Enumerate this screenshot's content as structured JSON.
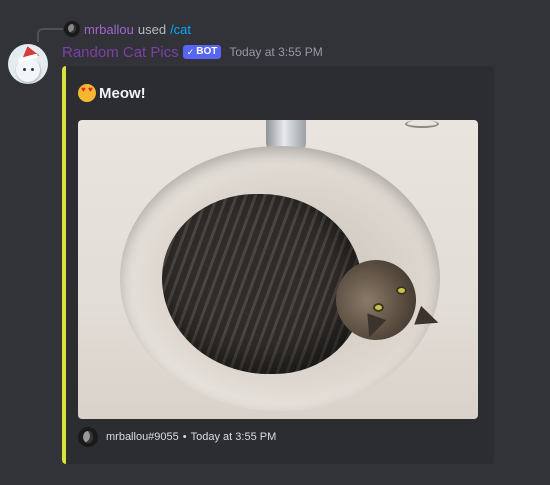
{
  "reply": {
    "username": "mrballou",
    "used_text": "used",
    "command": "/cat"
  },
  "message": {
    "author": "Random Cat Pics",
    "bot_badge": "BOT",
    "bot_check": "✓",
    "timestamp": "Today at 3:55 PM"
  },
  "embed": {
    "accent_color": "#d8e23a",
    "title_emoji": "smiling-cat-heart-eyes-icon",
    "title": "Meow!",
    "image_alt": "cat curled up in a bathroom sink",
    "footer": {
      "author": "mrballou#9055",
      "separator": "•",
      "timestamp": "Today at 3:55 PM"
    }
  },
  "colors": {
    "background": "#313338",
    "embed_background": "#2b2d31",
    "username": "#7e3fa8",
    "reply_username": "#a066d0",
    "command": "#00a8fc",
    "bot_badge": "#5865f2"
  }
}
